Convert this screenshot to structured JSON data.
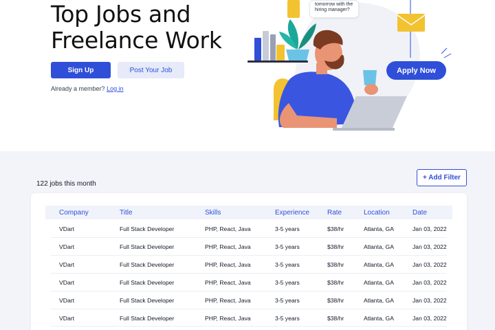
{
  "hero": {
    "title_line1": "Top Jobs and",
    "title_line2": "Freelance Work",
    "signup_label": "Sign Up",
    "post_job_label": "Post Your Job",
    "member_text": "Already a member?",
    "login_link": "Log in"
  },
  "illustration": {
    "speech_line1": "tomorrow with the",
    "speech_line2": "hiring manager?",
    "apply_label": "Apply Now"
  },
  "jobs": {
    "count_text": "122 jobs this month",
    "add_filter_label": "+ Add Filter",
    "columns": [
      "Company",
      "Title",
      "Skills",
      "Experience",
      "Rate",
      "Location",
      "Date"
    ],
    "rows": [
      [
        "VDart",
        "Full Stack Developer",
        "PHP, React, Java",
        "3-5 years",
        "$38/hr",
        "Atlanta, GA",
        "Jan 03, 2022"
      ],
      [
        "VDart",
        "Full Stack Developer",
        "PHP, React, Java",
        "3-5 years",
        "$38/hr",
        "Atlanta, GA",
        "Jan 03, 2022"
      ],
      [
        "VDart",
        "Full Stack Developer",
        "PHP, React, Java",
        "3-5 years",
        "$38/hr",
        "Atlanta, GA",
        "Jan 03, 2022"
      ],
      [
        "VDart",
        "Full Stack Developer",
        "PHP, React, Java",
        "3-5 years",
        "$38/hr",
        "Atlanta, GA",
        "Jan 03, 2022"
      ],
      [
        "VDart",
        "Full Stack Developer",
        "PHP, React, Java",
        "3-5 years",
        "$38/hr",
        "Atlanta, GA",
        "Jan 03, 2022"
      ],
      [
        "VDart",
        "Full Stack Developer",
        "PHP, React, Java",
        "3-5 years",
        "$38/hr",
        "Atlanta, GA",
        "Jan 03, 2022"
      ]
    ]
  },
  "colors": {
    "accent": "#2f4fd8",
    "accent_light": "#e6eaf9",
    "section_bg": "#f3f4f9",
    "header_bg": "#f1f3fb"
  }
}
